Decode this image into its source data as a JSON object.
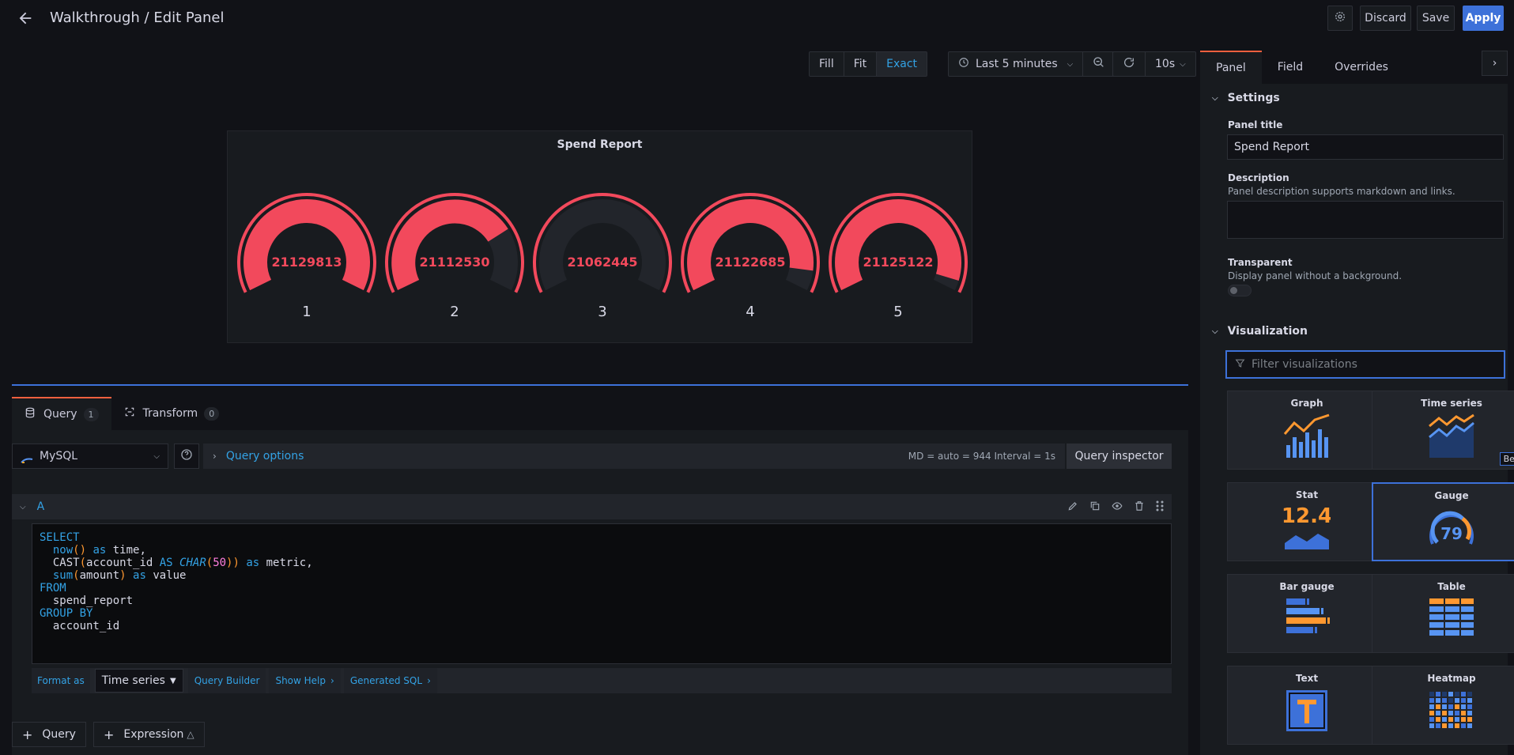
{
  "header": {
    "title": "Walkthrough / Edit Panel",
    "discard": "Discard",
    "save": "Save",
    "apply": "Apply"
  },
  "toolbar": {
    "fill": "Fill",
    "fit": "Fit",
    "exact": "Exact",
    "time_range": "Last 5 minutes",
    "refresh_interval": "10s"
  },
  "panel": {
    "title": "Spend Report",
    "gauges": [
      {
        "label": "1",
        "value": "21129813",
        "fill_fraction": 1.0
      },
      {
        "label": "2",
        "value": "21112530",
        "fill_fraction": 0.75
      },
      {
        "label": "3",
        "value": "21062445",
        "fill_fraction": 0.0
      },
      {
        "label": "4",
        "value": "21122685",
        "fill_fraction": 0.92
      },
      {
        "label": "5",
        "value": "21125122",
        "fill_fraction": 0.96
      }
    ],
    "color": "#f2495c"
  },
  "query_tabs": [
    {
      "label": "Query",
      "count": "1"
    },
    {
      "label": "Transform",
      "count": "0"
    }
  ],
  "query": {
    "datasource": "MySQL",
    "options_label": "Query options",
    "meta": "MD = auto = 944    Interval = 1s",
    "inspector": "Query inspector",
    "ref": "A",
    "format_label": "Format as",
    "format_value": "Time series",
    "builder": "Query Builder",
    "help": "Show Help",
    "sql": "Generated SQL",
    "add_query": "Query",
    "add_expression": "Expression"
  },
  "sidebar": {
    "tabs": [
      "Panel",
      "Field",
      "Overrides"
    ],
    "settings_heading": "Settings",
    "panel_title_label": "Panel title",
    "panel_title_value": "Spend Report",
    "description_label": "Description",
    "description_help": "Panel description supports markdown and links.",
    "transparent_label": "Transparent",
    "transparent_help": "Display panel without a background.",
    "visualization_heading": "Visualization",
    "filter_placeholder": "Filter visualizations",
    "viz": [
      "Graph",
      "Time series",
      "Stat",
      "Gauge",
      "Bar gauge",
      "Table",
      "Text",
      "Heatmap"
    ],
    "beta": "Beta",
    "stat_sample": "12.4",
    "gauge_sample": "79"
  }
}
